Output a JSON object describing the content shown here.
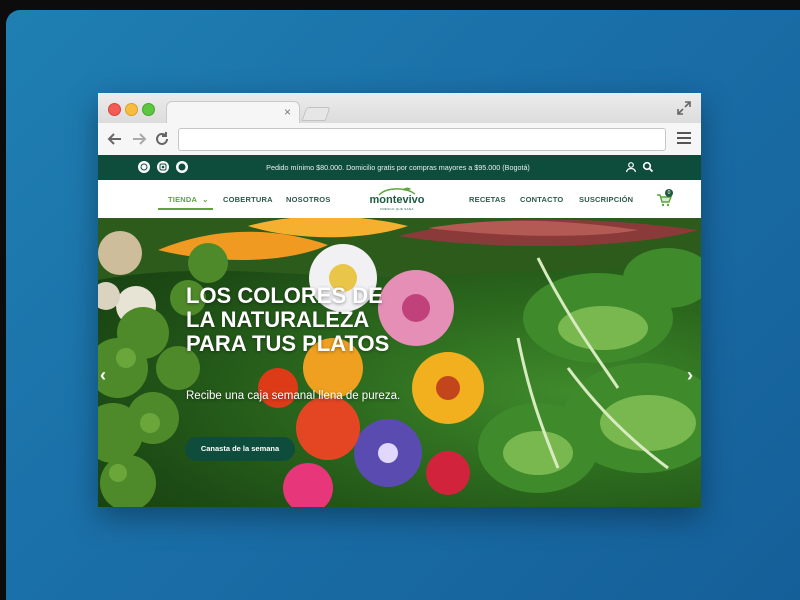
{
  "browser": {
    "tab_close": "×",
    "url": ""
  },
  "site": {
    "topbar": {
      "promo": "Pedido mínimo $80.000. Domicilio gratis por compras mayores a $95.000 (Bogotá)",
      "social_icons": [
        "whatsapp-icon",
        "instagram-icon",
        "facebook-icon"
      ]
    },
    "nav": {
      "left": [
        "TIENDA",
        "COBERTURA",
        "NOSOTROS"
      ],
      "right": [
        "RECETAS",
        "CONTACTO",
        "SUSCRIPCIÓN"
      ],
      "logo": "montevivo",
      "logo_tagline": "FRESCO QUE SANA",
      "cart_count": "0",
      "tienda_chevron": "⌄"
    },
    "hero": {
      "title": "LOS COLORES DE LA NATURALEZA PARA TUS PLATOS",
      "subtitle": "Recibe una caja semanal llena de pureza.",
      "button": "Canasta de la semana",
      "prev": "‹",
      "next": "›"
    }
  },
  "colors": {
    "brand_dark": "#0e4d3c",
    "accent_green": "#5ea33b",
    "background": "#1a6fa8"
  }
}
